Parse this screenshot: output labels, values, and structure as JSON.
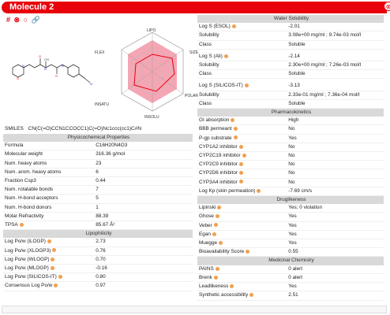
{
  "header": {
    "title": "Molecule 2",
    "close_icon": "close-circle-icon"
  },
  "toolbar": {
    "icons": [
      "hashtag-icon",
      "star-icon",
      "circle-icon",
      "link-icon"
    ],
    "glyphs": [
      "#",
      "⊗",
      "○",
      "🔗"
    ]
  },
  "radar": {
    "axes": [
      "LIPO",
      "SIZE",
      "POLAR",
      "INSOLU",
      "INSATU",
      "FLEX"
    ],
    "colors": {
      "band": "#f4a6b4",
      "polygon": "#e8000b"
    }
  },
  "smiles": {
    "label": "SMILES",
    "value": "CN(C(=O)CCN1CCOCC1)C(=O)Nc1ccc(cc1)C#N"
  },
  "physchem": {
    "title": "Physicochemical Properties",
    "rows": [
      [
        "Formula",
        "C16H20N4O3"
      ],
      [
        "Molecular weight",
        "316.36 g/mol"
      ],
      [
        "Num. heavy atoms",
        "23"
      ],
      [
        "Num. arom. heavy atoms",
        "6"
      ],
      [
        "Fraction Csp3",
        "0.44"
      ],
      [
        "Num. rotatable bonds",
        "7"
      ],
      [
        "Num. H-bond acceptors",
        "5"
      ],
      [
        "Num. H-bond donors",
        "1"
      ],
      [
        "Molar Refractivity",
        "88.39"
      ],
      [
        "TPSA",
        "85.67 Å²"
      ]
    ]
  },
  "lipophilicity": {
    "title": "Lipophilicity",
    "rows": [
      [
        "Log Po/w (iLOGP)",
        "2.73"
      ],
      [
        "Log Po/w (XLOGP3)",
        "0.76"
      ],
      [
        "Log Po/w (WLOGP)",
        "0.70"
      ],
      [
        "Log Po/w (MLOGP)",
        "-0.16"
      ],
      [
        "Log Po/w (SILICOS-IT)",
        "0.80"
      ],
      [
        "Consensus Log Po/w",
        "0.97"
      ]
    ]
  },
  "water": {
    "title": "Water Solubility",
    "rows": [
      [
        "Log S (ESOL)",
        "-2.01"
      ],
      [
        "Solubility",
        "3.08e+00 mg/ml ; 9.74e-03 mol/l"
      ],
      [
        "Class",
        "Soluble"
      ],
      [
        "",
        ""
      ],
      [
        "Log S (Ali)",
        "-2.14"
      ],
      [
        "Solubility",
        "2.30e+00 mg/ml ; 7.26e-03 mol/l"
      ],
      [
        "Class",
        "Soluble"
      ],
      [
        "",
        ""
      ],
      [
        "Log S (SILICOS-IT)",
        "-3.13"
      ],
      [
        "Solubility",
        "2.33e-01 mg/ml ; 7.36e-04 mol/l"
      ],
      [
        "Class",
        "Soluble"
      ]
    ]
  },
  "pk": {
    "title": "Pharmacokinetics",
    "rows": [
      [
        "GI absorption",
        "High"
      ],
      [
        "BBB permeant",
        "No"
      ],
      [
        "P-gp substrate",
        "Yes"
      ],
      [
        "CYP1A2 inhibitor",
        "No"
      ],
      [
        "CYP2C19 inhibitor",
        "No"
      ],
      [
        "CYP2C9 inhibitor",
        "No"
      ],
      [
        "CYP2D6 inhibitor",
        "No"
      ],
      [
        "CYP3A4 inhibitor",
        "No"
      ],
      [
        "Log Kp (skin permeation)",
        "-7.69 cm/s"
      ]
    ]
  },
  "druglike": {
    "title": "Druglikeness",
    "rows": [
      [
        "Lipinski",
        "Yes; 0 violation"
      ],
      [
        "Ghose",
        "Yes"
      ],
      [
        "Veber",
        "Yes"
      ],
      [
        "Egan",
        "Yes"
      ],
      [
        "Muegge",
        "Yes"
      ],
      [
        "Bioavailability Score",
        "0.55"
      ]
    ]
  },
  "medchem": {
    "title": "Medicinal Chemistry",
    "rows": [
      [
        "PAINS",
        "0 alert"
      ],
      [
        "Brenk",
        "0 alert"
      ],
      [
        "Leadlikeness",
        "Yes"
      ],
      [
        "Synthetic accessibility",
        "2.51"
      ]
    ]
  }
}
